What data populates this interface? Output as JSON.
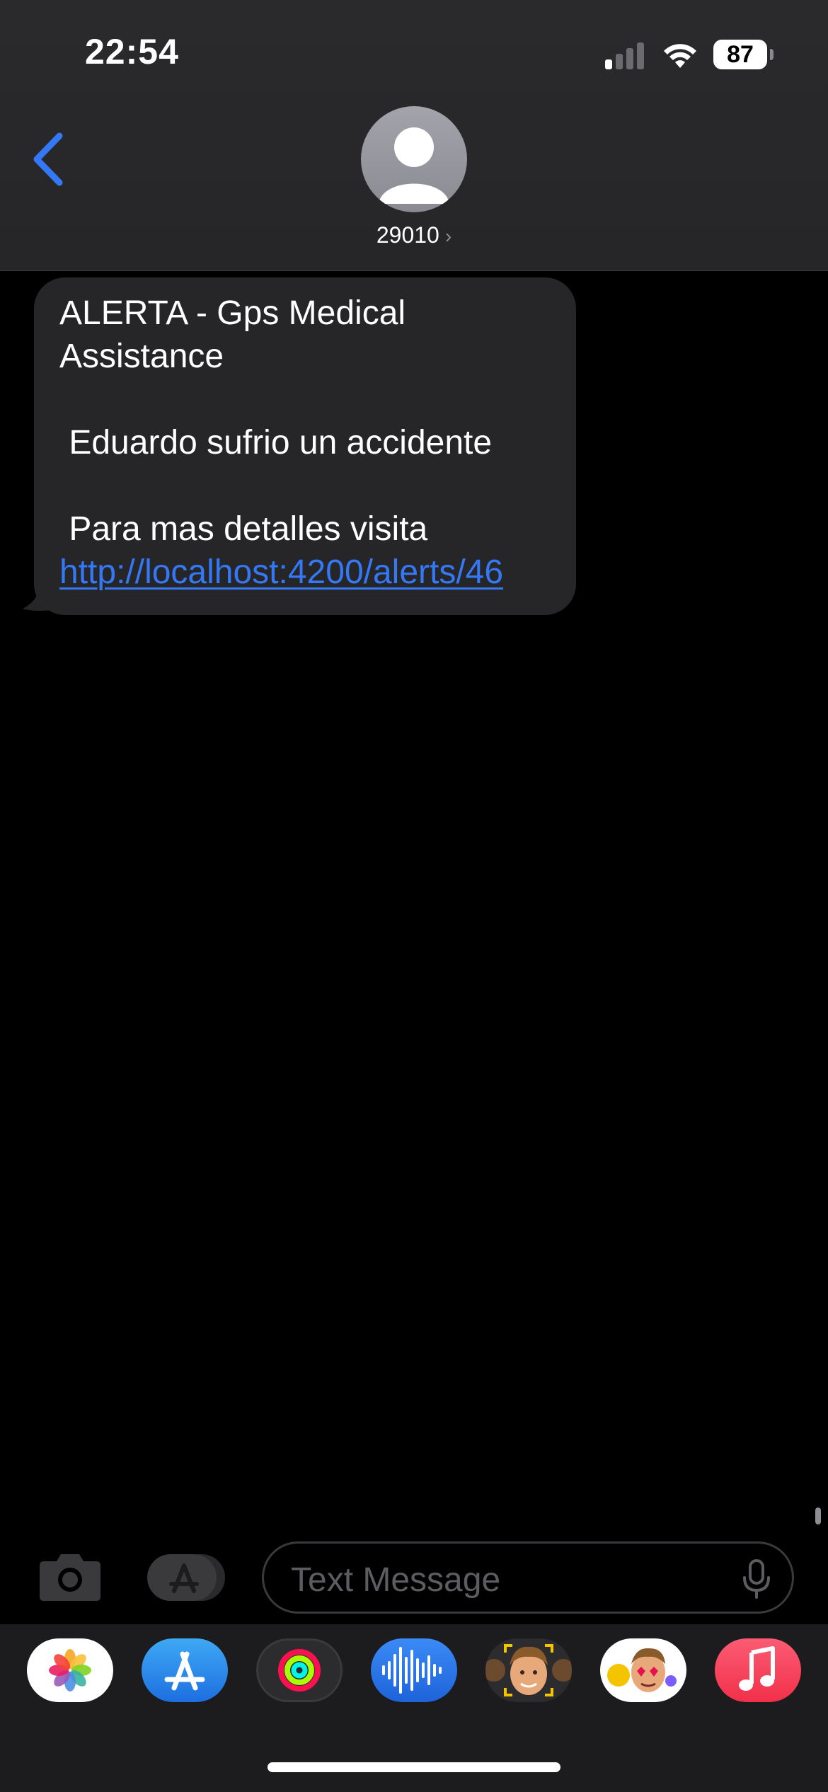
{
  "status_bar": {
    "time": "22:54",
    "battery": "87"
  },
  "conversation": {
    "contact": "29010",
    "chevron": "›"
  },
  "message": {
    "line1": "ALERTA - Gps Medical Assistance",
    "line2": " Eduardo sufrio un accidente",
    "line3_prefix": " Para mas detalles visita ",
    "link": "http://localhost:4200/alerts/46"
  },
  "composer": {
    "placeholder": "Text Message"
  },
  "app_drawer": {
    "apps": [
      "photos-icon",
      "app-store-icon",
      "activity-icon",
      "audio-message-icon",
      "memoji-icon",
      "memoji-stickers-icon",
      "music-icon"
    ]
  },
  "colors": {
    "link": "#3478f6",
    "back_chevron": "#3478f6",
    "bubble": "#262628"
  }
}
